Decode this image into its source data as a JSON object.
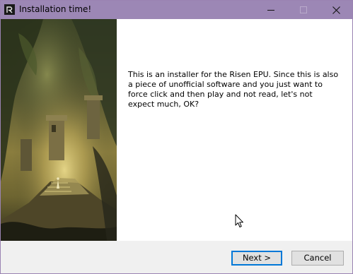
{
  "window": {
    "title": "Installation time!",
    "app_icon": "risen-app-icon",
    "titlebar_color": "#9c87b5",
    "controls": {
      "minimize_icon": "minimize-icon",
      "maximize_icon": "maximize-icon",
      "close_icon": "close-icon"
    }
  },
  "main": {
    "side_image": "jungle-ruins-artwork",
    "intro_text": "This is an installer for the Risen EPU. Since this is also a piece of unofficial software and you just want to force click and then play and not read, let's not expect much, OK?"
  },
  "footer": {
    "next_label": "Next >",
    "cancel_label": "Cancel",
    "focus_color": "#0078d7"
  }
}
